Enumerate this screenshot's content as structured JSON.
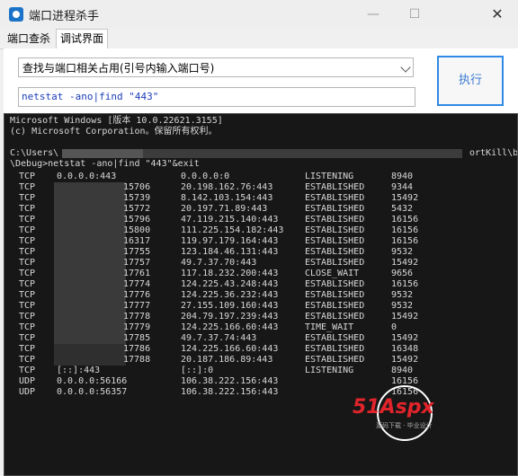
{
  "window": {
    "title": "端口进程杀手",
    "minimize": "—",
    "maximize": "☐",
    "close": "✕"
  },
  "tabs": [
    "端口查杀",
    "调试界面"
  ],
  "select": {
    "value": "查找与端口相关占用(引号内输入端口号)"
  },
  "command_input": {
    "value": "netstat -ano|find \"443\""
  },
  "execute_button": {
    "label": "执行"
  },
  "console": {
    "header": [
      "Microsoft Windows [版本 10.0.22621.3155]",
      "(c) Microsoft Corporation。保留所有权利。",
      "",
      "C:\\Users\\",
      "\\Debug>netstat -ano|find \"443\"&exit"
    ],
    "path_tail": "ortKill\\b",
    "rows": [
      [
        "TCP",
        "0.0.0.0:443",
        "0.0.0.0:0",
        "LISTENING",
        "8940"
      ],
      [
        "TCP",
        "15706",
        "20.198.162.76:443",
        "ESTABLISHED",
        "9344"
      ],
      [
        "TCP",
        "15739",
        "8.142.103.154:443",
        "ESTABLISHED",
        "15492"
      ],
      [
        "TCP",
        "15772",
        "20.197.71.89:443",
        "ESTABLISHED",
        "5432"
      ],
      [
        "TCP",
        "15796",
        "47.119.215.140:443",
        "ESTABLISHED",
        "16156"
      ],
      [
        "TCP",
        "15800",
        "111.225.154.182:443",
        "ESTABLISHED",
        "16156"
      ],
      [
        "TCP",
        "16317",
        "119.97.179.164:443",
        "ESTABLISHED",
        "16156"
      ],
      [
        "TCP",
        "17755",
        "123.184.46.131:443",
        "ESTABLISHED",
        "9532"
      ],
      [
        "TCP",
        "17757",
        "49.7.37.70:443",
        "ESTABLISHED",
        "15492"
      ],
      [
        "TCP",
        "17761",
        "117.18.232.200:443",
        "CLOSE_WAIT",
        "9656"
      ],
      [
        "TCP",
        "17774",
        "124.225.43.248:443",
        "ESTABLISHED",
        "16156"
      ],
      [
        "TCP",
        "17776",
        "124.225.36.232:443",
        "ESTABLISHED",
        "9532"
      ],
      [
        "TCP",
        "17777",
        "27.155.109.160:443",
        "ESTABLISHED",
        "9532"
      ],
      [
        "TCP",
        "17778",
        "204.79.197.239:443",
        "ESTABLISHED",
        "15492"
      ],
      [
        "TCP",
        "17779",
        "124.225.166.60:443",
        "TIME_WAIT",
        "0"
      ],
      [
        "TCP",
        "17785",
        "49.7.37.74:443",
        "ESTABLISHED",
        "15492"
      ],
      [
        "TCP",
        "17786",
        "124.225.166.60:443",
        "ESTABLISHED",
        "16348"
      ],
      [
        "TCP",
        "17788",
        "20.187.186.89:443",
        "ESTABLISHED",
        "15492"
      ],
      [
        "TCP",
        "[::]:443",
        "[::]:0",
        "LISTENING",
        "8940"
      ],
      [
        "UDP",
        "0.0.0.0:56166",
        "106.38.222.156:443",
        "",
        "16156"
      ],
      [
        "UDP",
        "0.0.0.0:56357",
        "106.38.222.156:443",
        "",
        "16156"
      ]
    ]
  },
  "watermark": {
    "brand": "51Aspx",
    "tagline": "源码下载 · 毕业设计",
    "colors": {
      "red": "#e0242b",
      "green": "#1f8a2e",
      "circle": "#ffffff"
    }
  }
}
